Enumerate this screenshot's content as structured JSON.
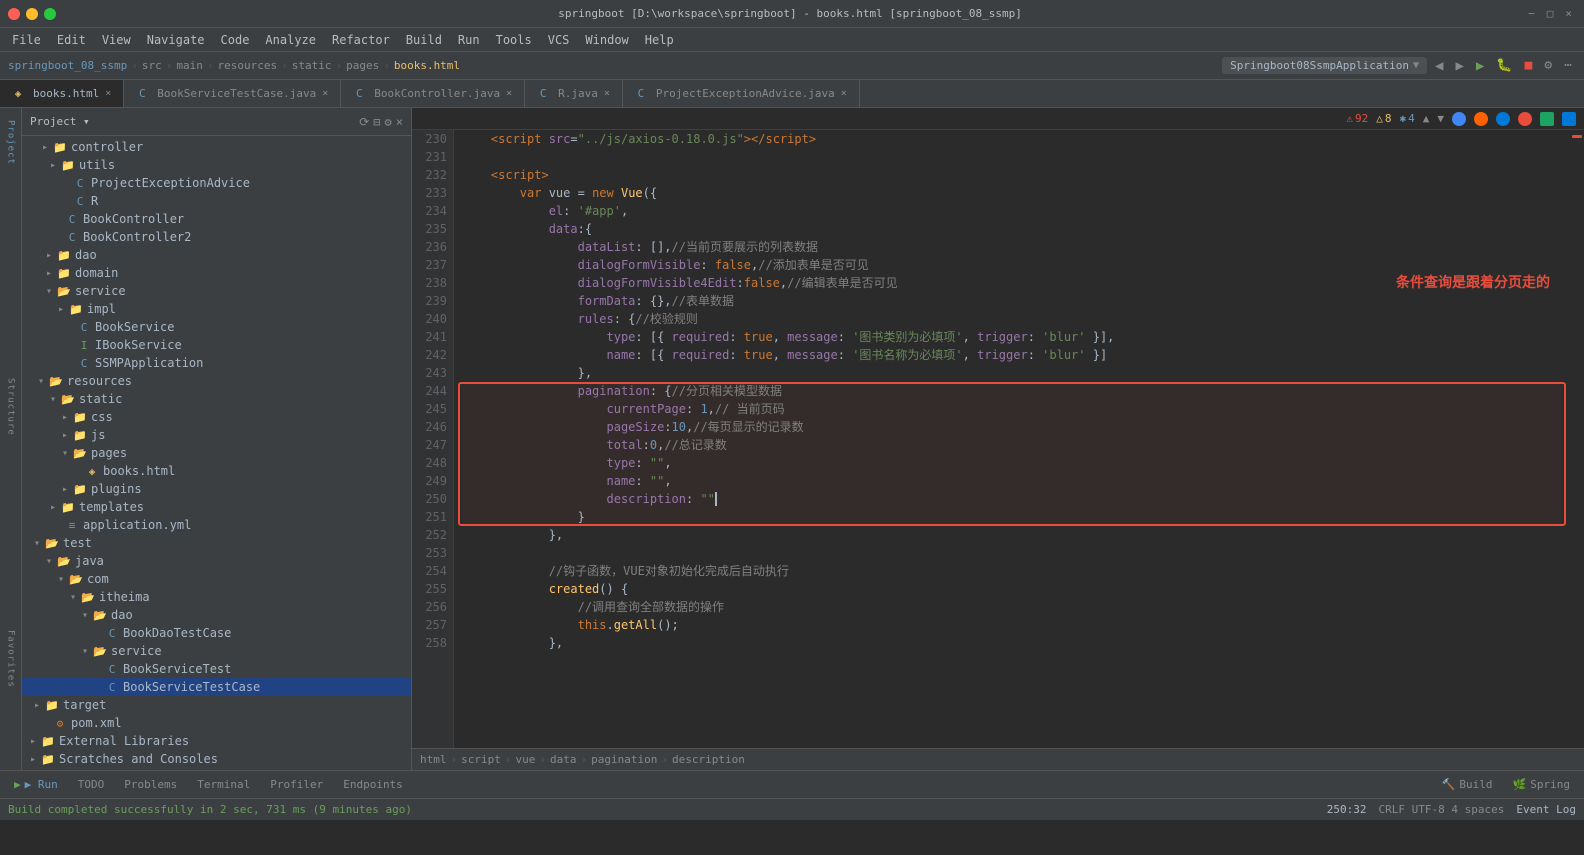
{
  "window": {
    "title": "springboot [D:\\workspace\\springboot] - books.html [springboot_08_ssmp]",
    "controls": [
      "−",
      "□",
      "×"
    ]
  },
  "menu": {
    "items": [
      "File",
      "Edit",
      "View",
      "Navigate",
      "Code",
      "Analyze",
      "Refactor",
      "Build",
      "Run",
      "Tools",
      "VCS",
      "Window",
      "Help"
    ]
  },
  "breadcrumb_top": {
    "items": [
      "springboot_08_ssmp",
      "src",
      "main",
      "resources",
      "static",
      "pages",
      "books.html",
      "vue",
      "data",
      "pagination",
      "description"
    ]
  },
  "run_config": {
    "label": "Springboot08SsmpApplication",
    "run_label": "▶ Run",
    "todo_label": "TODO",
    "problems_label": "Problems",
    "terminal_label": "Terminal",
    "profiler_label": "Profiler",
    "endpoints_label": "Endpoints",
    "build_label": "Build",
    "spring_label": "Spring"
  },
  "tabs": [
    {
      "name": "books.html",
      "type": "html",
      "active": true,
      "modified": false
    },
    {
      "name": "BookServiceTestCase.java",
      "type": "java",
      "active": false,
      "modified": false
    },
    {
      "name": "BookController.java",
      "type": "java",
      "active": false,
      "modified": false
    },
    {
      "name": "R.java",
      "type": "java",
      "active": false,
      "modified": false
    },
    {
      "name": "ProjectExceptionAdvice.java",
      "type": "java",
      "active": false,
      "modified": false
    }
  ],
  "sidebar": {
    "title": "Project",
    "tree": [
      {
        "id": "controller",
        "label": "controller",
        "type": "folder",
        "indent": 4,
        "expanded": false
      },
      {
        "id": "utils",
        "label": "utils",
        "type": "folder",
        "indent": 5,
        "expanded": false
      },
      {
        "id": "ProjectExceptionAdvice",
        "label": "ProjectExceptionAdvice",
        "type": "java-class",
        "indent": 6,
        "expanded": false
      },
      {
        "id": "R",
        "label": "R",
        "type": "java-class",
        "indent": 6,
        "expanded": false
      },
      {
        "id": "BookController",
        "label": "BookController",
        "type": "java-class",
        "indent": 5,
        "expanded": false
      },
      {
        "id": "BookController2",
        "label": "BookController2",
        "type": "java-class",
        "indent": 5,
        "expanded": false
      },
      {
        "id": "dao",
        "label": "dao",
        "type": "folder",
        "indent": 5,
        "expanded": false
      },
      {
        "id": "domain",
        "label": "domain",
        "type": "folder",
        "indent": 5,
        "expanded": false
      },
      {
        "id": "service",
        "label": "service",
        "type": "folder",
        "indent": 5,
        "expanded": true
      },
      {
        "id": "impl",
        "label": "impl",
        "type": "folder",
        "indent": 6,
        "expanded": false
      },
      {
        "id": "BookService",
        "label": "BookService",
        "type": "java-class",
        "indent": 6,
        "expanded": false
      },
      {
        "id": "IBookService",
        "label": "IBookService",
        "type": "java-interface",
        "indent": 6,
        "expanded": false
      },
      {
        "id": "SSMPApplication",
        "label": "SSMPApplication",
        "type": "java-class",
        "indent": 6,
        "expanded": false
      },
      {
        "id": "resources",
        "label": "resources",
        "type": "folder",
        "indent": 4,
        "expanded": true
      },
      {
        "id": "static",
        "label": "static",
        "type": "folder",
        "indent": 5,
        "expanded": true
      },
      {
        "id": "css",
        "label": "css",
        "type": "folder",
        "indent": 6,
        "expanded": false
      },
      {
        "id": "js",
        "label": "js",
        "type": "folder",
        "indent": 6,
        "expanded": false
      },
      {
        "id": "pages",
        "label": "pages",
        "type": "folder",
        "indent": 6,
        "expanded": true
      },
      {
        "id": "books.html",
        "label": "books.html",
        "type": "html",
        "indent": 7,
        "expanded": false
      },
      {
        "id": "plugins",
        "label": "plugins",
        "type": "folder",
        "indent": 6,
        "expanded": false
      },
      {
        "id": "templates",
        "label": "templates",
        "type": "folder",
        "indent": 5,
        "expanded": false
      },
      {
        "id": "application.yml",
        "label": "application.yml",
        "type": "yml",
        "indent": 5,
        "expanded": false
      },
      {
        "id": "test",
        "label": "test",
        "type": "folder",
        "indent": 3,
        "expanded": true
      },
      {
        "id": "java-test",
        "label": "java",
        "type": "folder",
        "indent": 4,
        "expanded": true
      },
      {
        "id": "com-test",
        "label": "com",
        "type": "folder",
        "indent": 5,
        "expanded": true
      },
      {
        "id": "itheima",
        "label": "itheima",
        "type": "folder",
        "indent": 6,
        "expanded": true
      },
      {
        "id": "dao-test",
        "label": "dao",
        "type": "folder",
        "indent": 7,
        "expanded": true
      },
      {
        "id": "BookDaoTestCase",
        "label": "BookDaoTestCase",
        "type": "java-class",
        "indent": 8,
        "expanded": false
      },
      {
        "id": "service-test",
        "label": "service",
        "type": "folder",
        "indent": 7,
        "expanded": true
      },
      {
        "id": "BookServiceTest",
        "label": "BookServiceTest",
        "type": "java-class",
        "indent": 8,
        "expanded": false
      },
      {
        "id": "BookServiceTestCase",
        "label": "BookServiceTestCase",
        "type": "java-class-selected",
        "indent": 8,
        "expanded": false
      },
      {
        "id": "target",
        "label": "target",
        "type": "folder",
        "indent": 3,
        "expanded": false
      },
      {
        "id": "pom.xml",
        "label": "pom.xml",
        "type": "pom",
        "indent": 3,
        "expanded": false
      },
      {
        "id": "external-libraries",
        "label": "External Libraries",
        "type": "folder",
        "indent": 2,
        "expanded": false
      },
      {
        "id": "scratches",
        "label": "Scratches and Consoles",
        "type": "folder",
        "indent": 2,
        "expanded": false
      }
    ]
  },
  "editor": {
    "lines": [
      {
        "num": 230,
        "content": "    <script src=\"../js/axios-0.18.0.js\"><\\/script>",
        "type": "html"
      },
      {
        "num": 231,
        "content": "",
        "type": "blank"
      },
      {
        "num": 232,
        "content": "    <script>",
        "type": "html"
      },
      {
        "num": 233,
        "content": "        var vue = new Vue({",
        "type": "code"
      },
      {
        "num": 234,
        "content": "            el: '#app',",
        "type": "code"
      },
      {
        "num": 235,
        "content": "            data:{",
        "type": "code"
      },
      {
        "num": 236,
        "content": "                dataList: [],//当前页要展示的列表数据",
        "type": "code-comment"
      },
      {
        "num": 237,
        "content": "                dialogFormVisible: false,//添加表单是否可见",
        "type": "code-comment"
      },
      {
        "num": 238,
        "content": "                dialogFormVisible4Edit:false,//编辑表单是否可见",
        "type": "code-comment"
      },
      {
        "num": 239,
        "content": "                formData: {},//表单数据",
        "type": "code-comment"
      },
      {
        "num": 240,
        "content": "                rules: {//校验规则",
        "type": "code-comment"
      },
      {
        "num": 241,
        "content": "                    type: [{ required: true, message: '图书类别为必填项', trigger: 'blur' }],",
        "type": "code"
      },
      {
        "num": 242,
        "content": "                    name: [{ required: true, message: '图书名称为必填项', trigger: 'blur' }]",
        "type": "code"
      },
      {
        "num": 243,
        "content": "                },",
        "type": "code"
      },
      {
        "num": 244,
        "content": "                pagination: {//分页相关模型数据",
        "type": "code-comment-highlighted"
      },
      {
        "num": 245,
        "content": "                    currentPage: 1,// 当前页码",
        "type": "code-comment-highlighted"
      },
      {
        "num": 246,
        "content": "                    pageSize:10,//每页显示的记录数",
        "type": "code-comment-highlighted"
      },
      {
        "num": 247,
        "content": "                    total:0,//总记录数",
        "type": "code-comment-highlighted"
      },
      {
        "num": 248,
        "content": "                    type: \"\",",
        "type": "code-highlighted"
      },
      {
        "num": 249,
        "content": "                    name: \"\",",
        "type": "code-highlighted"
      },
      {
        "num": 250,
        "content": "                    description: \"\"|",
        "type": "code-highlighted-cursor"
      },
      {
        "num": 251,
        "content": "                }",
        "type": "code-highlighted"
      },
      {
        "num": 252,
        "content": "            },",
        "type": "code"
      },
      {
        "num": 253,
        "content": "",
        "type": "blank"
      },
      {
        "num": 254,
        "content": "            //钩子函数，VUE对象初始化完成后自动执行",
        "type": "comment"
      },
      {
        "num": 255,
        "content": "            created() {",
        "type": "code"
      },
      {
        "num": 256,
        "content": "                //调用查询全部数据的操作",
        "type": "comment"
      },
      {
        "num": 257,
        "content": "                this.getAll();",
        "type": "code"
      },
      {
        "num": 258,
        "content": "            },",
        "type": "code"
      }
    ],
    "annotation": "条件查询是跟着分页走的",
    "red_box_start_line": 244,
    "red_box_end_line": 251
  },
  "breadcrumb_bottom": {
    "items": [
      "html",
      "script",
      "vue",
      "data",
      "pagination",
      "description"
    ]
  },
  "status_bar": {
    "build_status": "Build completed successfully in 2 sec, 731 ms (9 minutes ago)",
    "position": "250:32",
    "encoding": "CRLF  UTF-8  4 spaces",
    "errors": "92",
    "warnings": "8",
    "other": "4",
    "event_log": "Event Log"
  },
  "left_panel": {
    "items": [
      "Project",
      "Structure",
      "Favorites"
    ]
  }
}
